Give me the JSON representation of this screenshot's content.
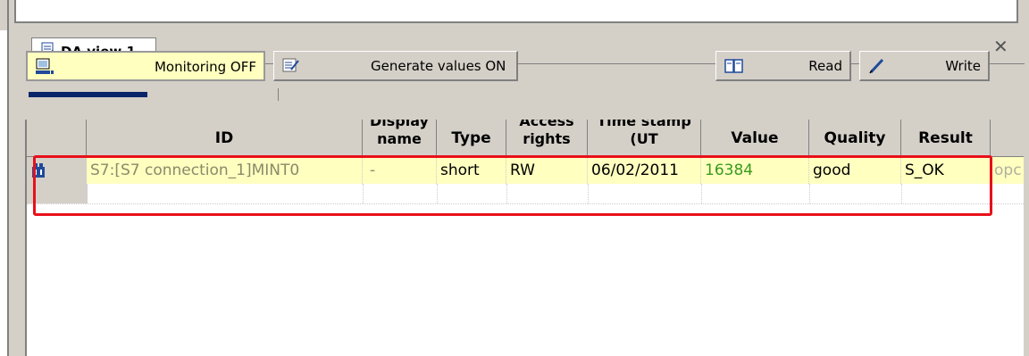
{
  "tab": {
    "label": "DA view 1"
  },
  "toolbar": {
    "monitoring_label": "Monitoring OFF",
    "generate_label": "Generate values ON",
    "read_label": "Read",
    "write_label": "Write",
    "monitoring_progress": 0.5
  },
  "grid": {
    "columns": [
      "ID",
      "Display name",
      "Type",
      "Access rights",
      "Time stamp (UT",
      "Value",
      "Quality",
      "Result"
    ],
    "rows": [
      {
        "id": "S7:[S7 connection_1]MINT0",
        "display_name": "-",
        "type": "short",
        "access": "RW",
        "timestamp": "06/02/2011",
        "value": "16384",
        "quality": "good",
        "result": "S_OK",
        "extra": "opc"
      }
    ]
  },
  "colors": {
    "highlight": "#ffffc0",
    "selection": "#e8101a",
    "value_text": "#3a9a1e"
  }
}
